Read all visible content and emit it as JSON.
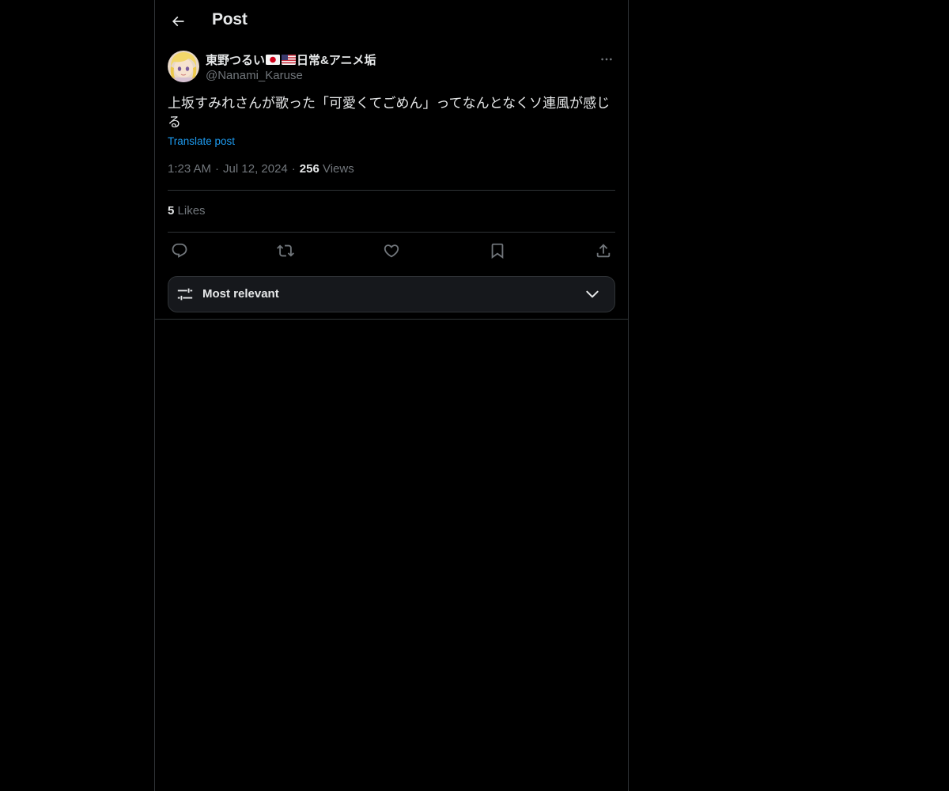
{
  "header": {
    "title": "Post",
    "back_icon": "arrow-left-icon"
  },
  "author": {
    "name_part1": "東野つるい",
    "flags": [
      "japan-flag-icon",
      "usa-flag-icon"
    ],
    "name_part2": "日常&アニメ垢",
    "handle": "@Nanami_Karuse",
    "more_icon": "more-icon"
  },
  "post": {
    "text": "上坂すみれさんが歌った「可愛くてごめん」ってなんとなくソ連風が感じる",
    "translate_label": "Translate post",
    "time": "1:23 AM",
    "date": "Jul 12, 2024",
    "views_count": "256",
    "views_label": "Views"
  },
  "stats": {
    "likes_count": "5",
    "likes_label": "Likes"
  },
  "actions": [
    {
      "name": "reply-icon"
    },
    {
      "name": "repost-icon"
    },
    {
      "name": "like-icon"
    },
    {
      "name": "bookmark-icon"
    },
    {
      "name": "share-icon"
    }
  ],
  "sort": {
    "label": "Most relevant",
    "icon": "filter-icon",
    "chevron": "chevron-down-icon"
  },
  "colors": {
    "background": "#000000",
    "text": "#e7e9ea",
    "secondary": "#71767b",
    "link": "#1d9bf0",
    "border": "#2f3336"
  }
}
